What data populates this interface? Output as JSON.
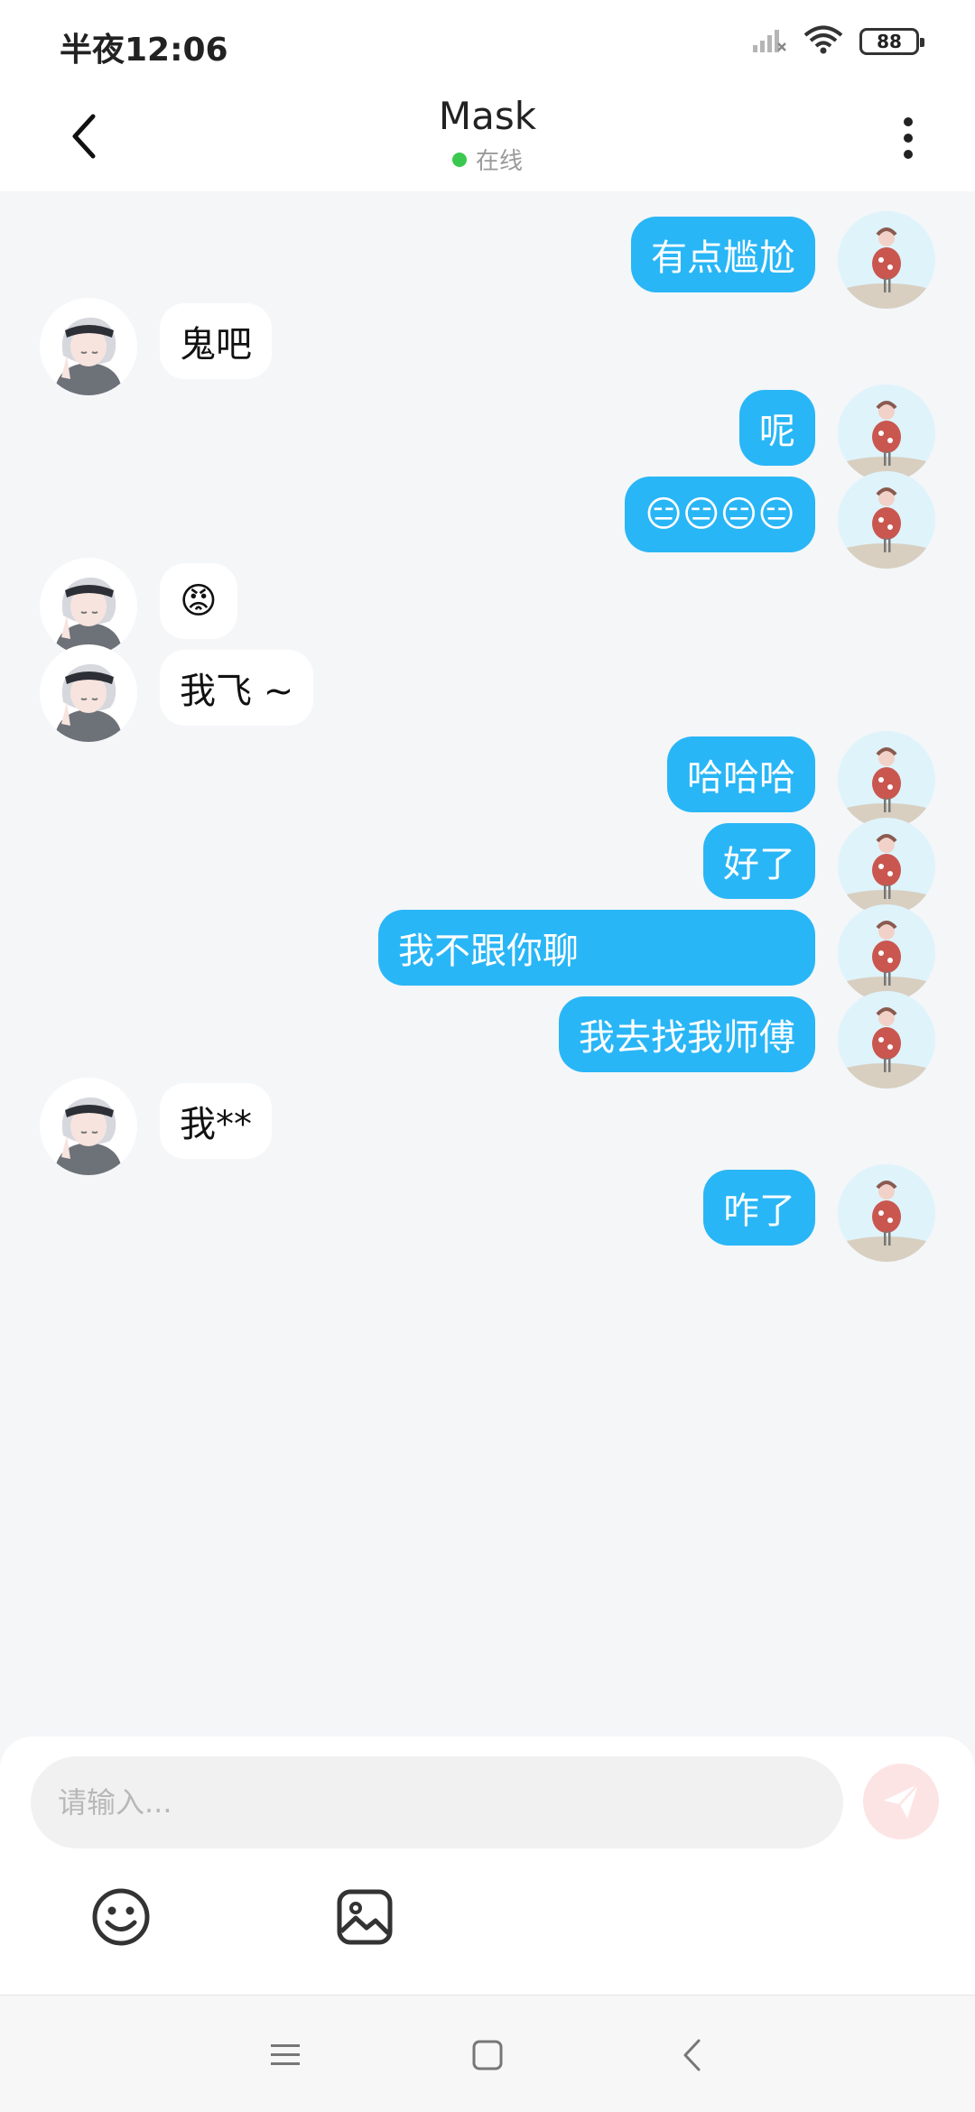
{
  "status_bar": {
    "time": "半夜12:06",
    "battery": "88",
    "icons": [
      "signal-icon",
      "wifi-icon",
      "battery-icon"
    ]
  },
  "header": {
    "title": "Mask",
    "status": "在线",
    "back_icon": "chevron-left-icon",
    "more_icon": "more-vertical-icon"
  },
  "messages": [
    {
      "from": "me",
      "text": "有点尴尬"
    },
    {
      "from": "them",
      "text": "鬼吧"
    },
    {
      "from": "me",
      "text": "呢"
    },
    {
      "from": "me",
      "text": "😑😑😑😑"
    },
    {
      "from": "them",
      "text": "😡"
    },
    {
      "from": "them",
      "text": "我飞 ~"
    },
    {
      "from": "me",
      "text": "哈哈哈"
    },
    {
      "from": "me",
      "text": "好了"
    },
    {
      "from": "me",
      "text": "我不跟你聊"
    },
    {
      "from": "me",
      "text": "我去找我师傅"
    },
    {
      "from": "them",
      "text": "我**"
    },
    {
      "from": "me",
      "text": "咋了"
    }
  ],
  "input": {
    "placeholder": "请输入...",
    "value": ""
  },
  "toolbar": {
    "emoji_icon": "smiley-icon",
    "image_icon": "image-icon",
    "send_icon": "send-icon"
  },
  "nav": {
    "icons": [
      "menu-icon",
      "home-icon",
      "back-icon"
    ]
  },
  "colors": {
    "outgoing_bubble": "#29b6f6",
    "incoming_bubble": "#ffffff",
    "online": "#3ac94e",
    "background": "#f4f6f8"
  }
}
